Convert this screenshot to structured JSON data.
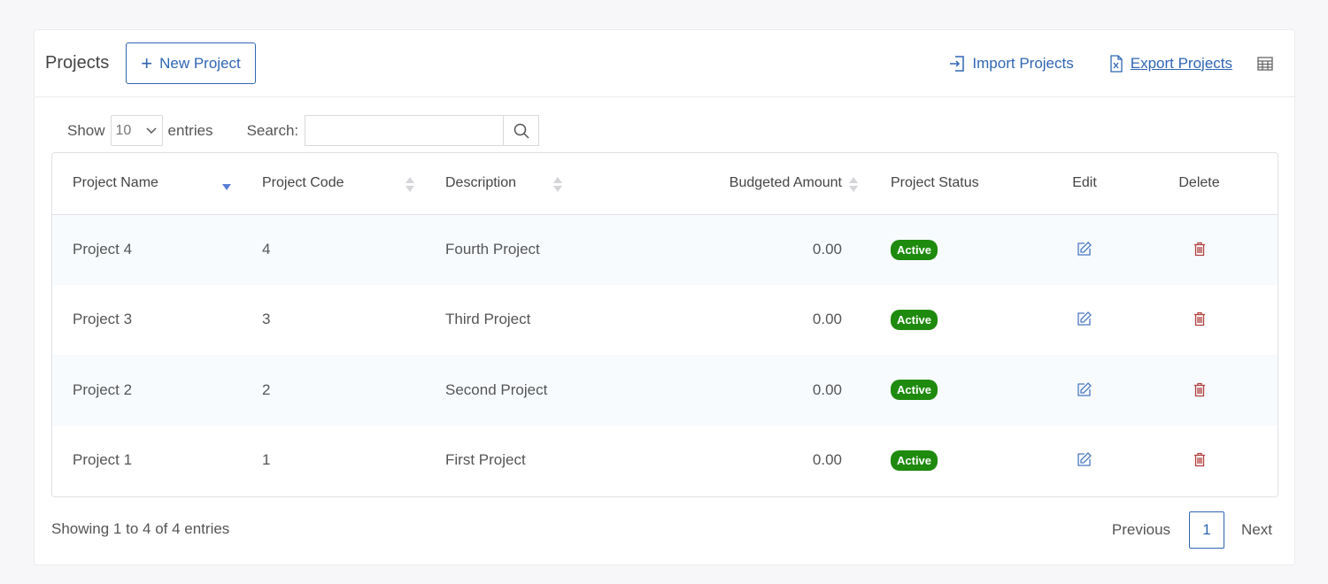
{
  "header": {
    "title": "Projects",
    "new_button": "New Project",
    "import_label": "Import Projects",
    "export_label": "Export Projects"
  },
  "controls": {
    "show_label": "Show",
    "entries_value": "10",
    "entries_label": "entries",
    "search_label": "Search:",
    "search_value": ""
  },
  "table": {
    "columns": [
      "Project Name",
      "Project Code",
      "Description",
      "Budgeted Amount",
      "Project Status",
      "Edit",
      "Delete"
    ],
    "rows": [
      {
        "name": "Project 4",
        "code": "4",
        "description": "Fourth Project",
        "amount": "0.00",
        "status": "Active"
      },
      {
        "name": "Project 3",
        "code": "3",
        "description": "Third Project",
        "amount": "0.00",
        "status": "Active"
      },
      {
        "name": "Project 2",
        "code": "2",
        "description": "Second Project",
        "amount": "0.00",
        "status": "Active"
      },
      {
        "name": "Project 1",
        "code": "1",
        "description": "First Project",
        "amount": "0.00",
        "status": "Active"
      }
    ]
  },
  "footer": {
    "info": "Showing 1 to 4 of 4 entries",
    "previous": "Previous",
    "page": "1",
    "next": "Next"
  },
  "icons": {
    "plus": "plus-icon",
    "import": "import-icon",
    "export": "excel-file-icon",
    "grid": "table-grid-icon",
    "search": "search-icon",
    "edit": "edit-icon",
    "delete": "trash-icon"
  },
  "colors": {
    "accent": "#2f66b3",
    "status_active": "#1e8a0e",
    "delete": "#b0413e"
  }
}
